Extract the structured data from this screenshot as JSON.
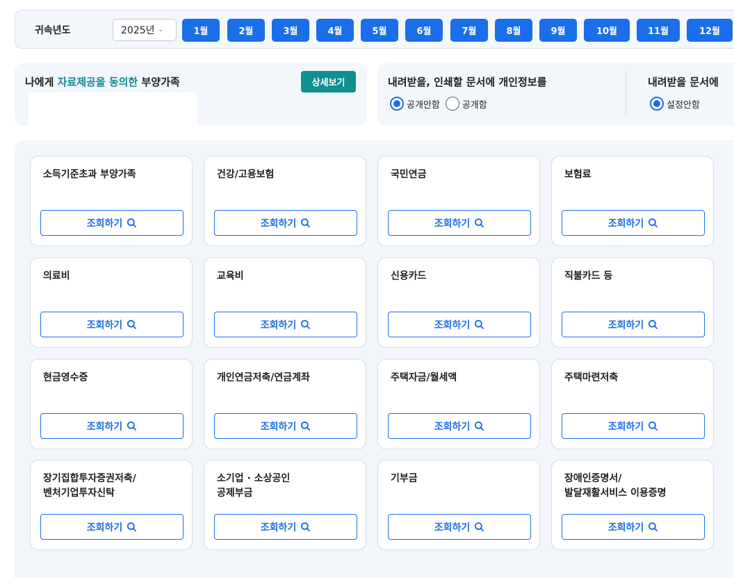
{
  "year_bar": {
    "label": "귀속년도",
    "year_value": "2025년",
    "months": [
      "1월",
      "2월",
      "3월",
      "4월",
      "5월",
      "6월",
      "7월",
      "8월",
      "9월",
      "10월",
      "11월",
      "12월"
    ]
  },
  "dependents": {
    "title_prefix": "나에게 ",
    "title_highlight": "자료제공을 동의한",
    "title_suffix": " 부양가족",
    "detail_button": "상세보기"
  },
  "privacy": {
    "doc_title": "내려받을, 인쇄할 문서에 개인정보를",
    "doc_options": [
      {
        "label": "공개안함",
        "checked": true
      },
      {
        "label": "공개함",
        "checked": false
      }
    ],
    "setting_title": "내려받을 문서에",
    "setting_options": [
      {
        "label": "설정안함",
        "checked": true
      }
    ]
  },
  "categories": [
    {
      "title": "소득기준초과 부양가족",
      "button": "조회하기"
    },
    {
      "title": "건강/고용보험",
      "button": "조회하기"
    },
    {
      "title": "국민연금",
      "button": "조회하기"
    },
    {
      "title": "보험료",
      "button": "조회하기"
    },
    {
      "title": "의료비",
      "button": "조회하기"
    },
    {
      "title": "교육비",
      "button": "조회하기"
    },
    {
      "title": "신용카드",
      "button": "조회하기"
    },
    {
      "title": "직불카드 등",
      "button": "조회하기"
    },
    {
      "title": "현금영수증",
      "button": "조회하기"
    },
    {
      "title": "개인연금저축/연금계좌",
      "button": "조회하기"
    },
    {
      "title": "주택자금/월세액",
      "button": "조회하기"
    },
    {
      "title": "주택마련저축",
      "button": "조회하기"
    },
    {
      "title": "장기집합투자증권저축/\n벤처기업투자신탁",
      "button": "조회하기"
    },
    {
      "title": "소기업 · 소상공인\n공제부금",
      "button": "조회하기"
    },
    {
      "title": "기부금",
      "button": "조회하기"
    },
    {
      "title": "장애인증명서/\n발달재활서비스 이용증명",
      "button": "조회하기"
    }
  ],
  "colors": {
    "primary": "#1a6ee8",
    "teal": "#0f8f91",
    "highlight_text": "#138a96",
    "panel_bg": "#f3f6fa"
  },
  "icons": {
    "search": "search-icon",
    "select_chevron": "chevron-down-icon"
  }
}
